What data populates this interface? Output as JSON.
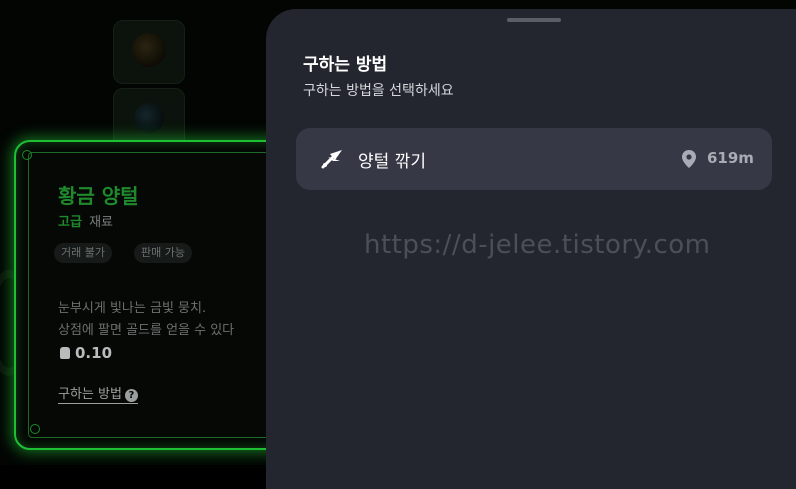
{
  "item_card": {
    "name": "황금 양털",
    "grade": "고급",
    "category": "재료",
    "tags": [
      "거래 불가",
      "판매 가능"
    ],
    "description_lines": [
      "눈부시게 빛나는 금빛 뭉치.",
      "상점에 팔면 골드를 얻을 수 있다"
    ],
    "weight": "0.10",
    "acquire_link": "구하는 방법",
    "grade_color": "#1f8a2d",
    "glow_color": "#1fbf34"
  },
  "sheet": {
    "title": "구하는 방법",
    "subtitle": "구하는 방법을 선택하세요",
    "methods": [
      {
        "icon": "shears-icon",
        "label": "양털 깎기",
        "distance": "619m"
      }
    ],
    "watermark": "https://d-jelee.tistory.com",
    "background_color": "#23262f",
    "item_color": "#363845"
  }
}
